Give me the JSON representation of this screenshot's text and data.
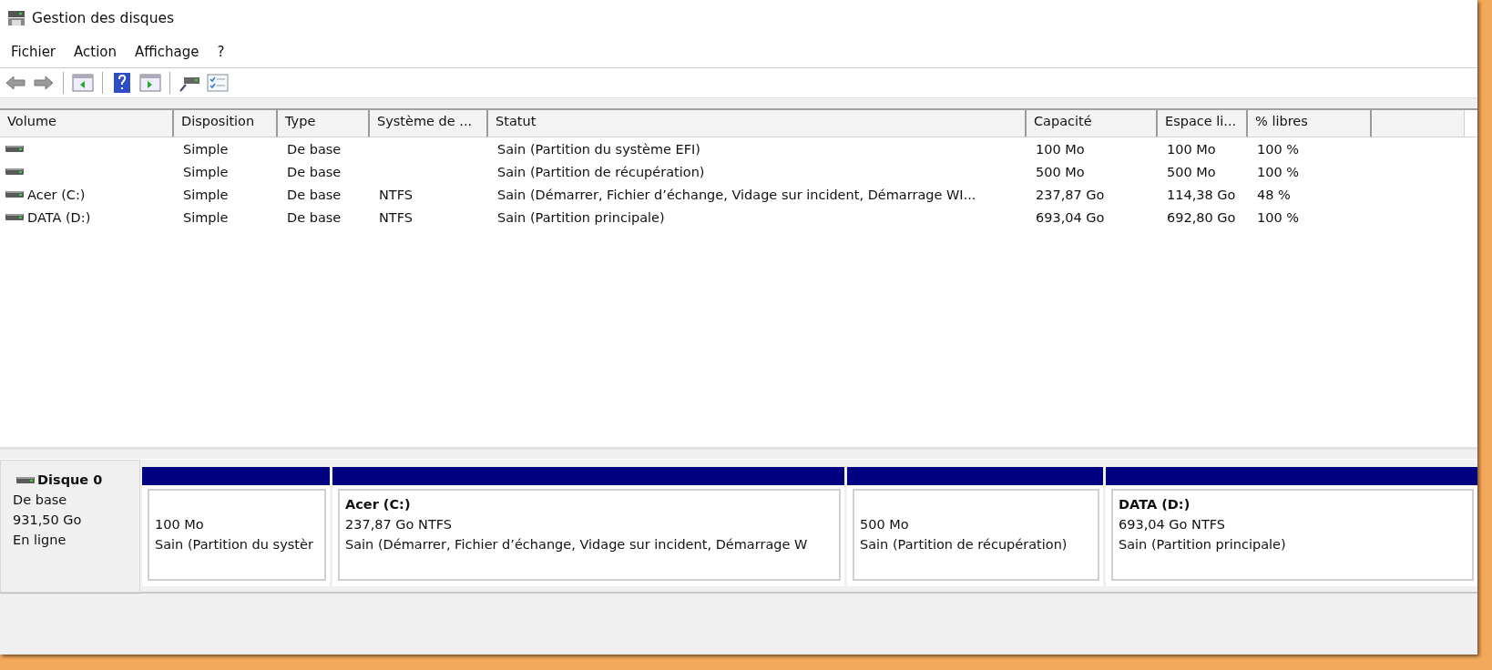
{
  "window": {
    "title": "Gestion des disques"
  },
  "menu": [
    "Fichier",
    "Action",
    "Affichage",
    "?"
  ],
  "table": {
    "columns": [
      "Volume",
      "Disposition",
      "Type",
      "Système de ...",
      "Statut",
      "Capacité",
      "Espace li...",
      "% libres"
    ],
    "rows": [
      {
        "layout": "Simple",
        "type": "De base",
        "status": "Sain (Partition du système EFI)",
        "capacity": "100 Mo",
        "free": "100 Mo",
        "pct": "100 %"
      },
      {
        "layout": "Simple",
        "type": "De base",
        "status": "Sain (Partition de récupération)",
        "capacity": "500 Mo",
        "free": "500 Mo",
        "pct": "100 %"
      },
      {
        "volume": "Acer (C:)",
        "layout": "Simple",
        "type": "De base",
        "fs": "NTFS",
        "status": "Sain (Démarrer, Fichier d’échange, Vidage sur incident, Démarrage WI...",
        "capacity": "237,87 Go",
        "free": "114,38 Go",
        "pct": "48 %"
      },
      {
        "volume": "DATA (D:)",
        "layout": "Simple",
        "type": "De base",
        "fs": "NTFS",
        "status": "Sain (Partition principale)",
        "capacity": "693,04 Go",
        "free": "692,80 Go",
        "pct": "100 %"
      }
    ]
  },
  "disk": {
    "name": "Disque 0",
    "type": "De base",
    "size": "931,50 Go",
    "status": "En ligne",
    "partitions": [
      {
        "size": "100 Mo",
        "status": "Sain (Partition du systèr"
      },
      {
        "name": "Acer  (C:)",
        "size": "237,87 Go NTFS",
        "status": "Sain (Démarrer, Fichier d’échange, Vidage sur incident, Démarrage W"
      },
      {
        "size": "500 Mo",
        "status": "Sain (Partition de récupération)"
      },
      {
        "name": "DATA  (D:)",
        "size": "693,04 Go NTFS",
        "status": "Sain (Partition principale)"
      }
    ]
  }
}
